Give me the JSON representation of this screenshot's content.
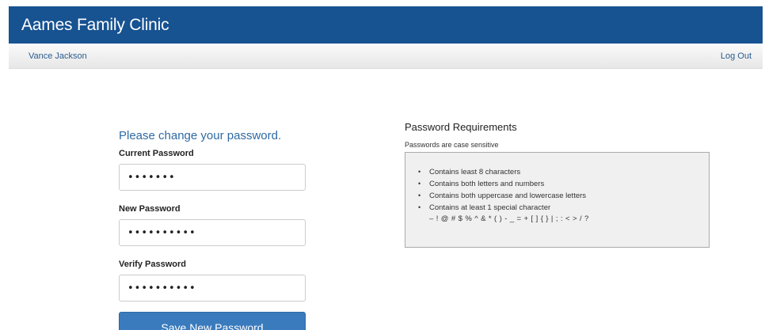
{
  "app": {
    "title": "Aames Family Clinic"
  },
  "nav": {
    "user_name": "Vance Jackson",
    "logout_label": "Log Out"
  },
  "form": {
    "heading": "Please change your password.",
    "current": {
      "label": "Current Password",
      "value": "•••••••"
    },
    "new": {
      "label": "New Password",
      "value": "••••••••••"
    },
    "verify": {
      "label": "Verify Password",
      "value": "••••••••••"
    },
    "submit_label": "Save New Password"
  },
  "requirements": {
    "heading": "Password Requirements",
    "note": "Passwords are case sensitive",
    "items": [
      "Contains least 8 characters",
      "Contains both letters and numbers",
      "Contains both uppercase and lowercase letters",
      "Contains at least 1 special character"
    ],
    "special_chars": "– ! @ # $ % ^ & * ( ) - _ = + [ ] { } | ; : < > / ?",
    "bullet": "•"
  },
  "colors": {
    "header_bg": "#175291",
    "accent": "#3a7bbd"
  }
}
